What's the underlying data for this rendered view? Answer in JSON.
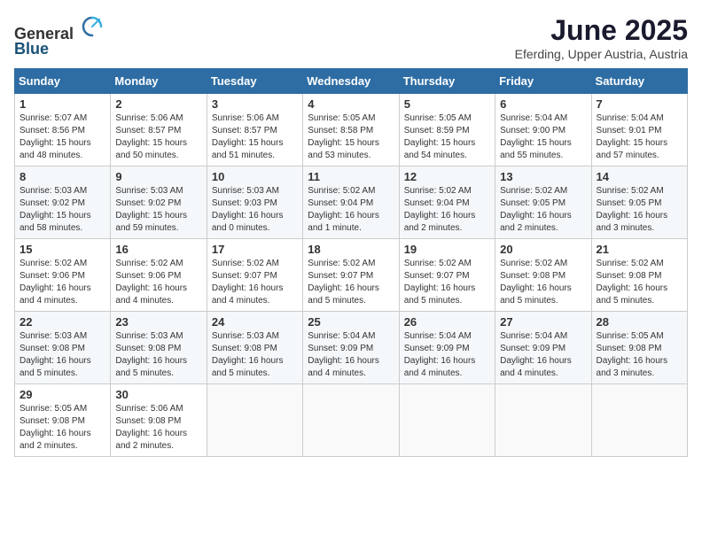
{
  "logo": {
    "general": "General",
    "blue": "Blue"
  },
  "title": "June 2025",
  "subtitle": "Eferding, Upper Austria, Austria",
  "weekdays": [
    "Sunday",
    "Monday",
    "Tuesday",
    "Wednesday",
    "Thursday",
    "Friday",
    "Saturday"
  ],
  "weeks": [
    [
      {
        "day": "1",
        "info": "Sunrise: 5:07 AM\nSunset: 8:56 PM\nDaylight: 15 hours\nand 48 minutes."
      },
      {
        "day": "2",
        "info": "Sunrise: 5:06 AM\nSunset: 8:57 PM\nDaylight: 15 hours\nand 50 minutes."
      },
      {
        "day": "3",
        "info": "Sunrise: 5:06 AM\nSunset: 8:57 PM\nDaylight: 15 hours\nand 51 minutes."
      },
      {
        "day": "4",
        "info": "Sunrise: 5:05 AM\nSunset: 8:58 PM\nDaylight: 15 hours\nand 53 minutes."
      },
      {
        "day": "5",
        "info": "Sunrise: 5:05 AM\nSunset: 8:59 PM\nDaylight: 15 hours\nand 54 minutes."
      },
      {
        "day": "6",
        "info": "Sunrise: 5:04 AM\nSunset: 9:00 PM\nDaylight: 15 hours\nand 55 minutes."
      },
      {
        "day": "7",
        "info": "Sunrise: 5:04 AM\nSunset: 9:01 PM\nDaylight: 15 hours\nand 57 minutes."
      }
    ],
    [
      {
        "day": "8",
        "info": "Sunrise: 5:03 AM\nSunset: 9:02 PM\nDaylight: 15 hours\nand 58 minutes."
      },
      {
        "day": "9",
        "info": "Sunrise: 5:03 AM\nSunset: 9:02 PM\nDaylight: 15 hours\nand 59 minutes."
      },
      {
        "day": "10",
        "info": "Sunrise: 5:03 AM\nSunset: 9:03 PM\nDaylight: 16 hours\nand 0 minutes."
      },
      {
        "day": "11",
        "info": "Sunrise: 5:02 AM\nSunset: 9:04 PM\nDaylight: 16 hours\nand 1 minute."
      },
      {
        "day": "12",
        "info": "Sunrise: 5:02 AM\nSunset: 9:04 PM\nDaylight: 16 hours\nand 2 minutes."
      },
      {
        "day": "13",
        "info": "Sunrise: 5:02 AM\nSunset: 9:05 PM\nDaylight: 16 hours\nand 2 minutes."
      },
      {
        "day": "14",
        "info": "Sunrise: 5:02 AM\nSunset: 9:05 PM\nDaylight: 16 hours\nand 3 minutes."
      }
    ],
    [
      {
        "day": "15",
        "info": "Sunrise: 5:02 AM\nSunset: 9:06 PM\nDaylight: 16 hours\nand 4 minutes."
      },
      {
        "day": "16",
        "info": "Sunrise: 5:02 AM\nSunset: 9:06 PM\nDaylight: 16 hours\nand 4 minutes."
      },
      {
        "day": "17",
        "info": "Sunrise: 5:02 AM\nSunset: 9:07 PM\nDaylight: 16 hours\nand 4 minutes."
      },
      {
        "day": "18",
        "info": "Sunrise: 5:02 AM\nSunset: 9:07 PM\nDaylight: 16 hours\nand 5 minutes."
      },
      {
        "day": "19",
        "info": "Sunrise: 5:02 AM\nSunset: 9:07 PM\nDaylight: 16 hours\nand 5 minutes."
      },
      {
        "day": "20",
        "info": "Sunrise: 5:02 AM\nSunset: 9:08 PM\nDaylight: 16 hours\nand 5 minutes."
      },
      {
        "day": "21",
        "info": "Sunrise: 5:02 AM\nSunset: 9:08 PM\nDaylight: 16 hours\nand 5 minutes."
      }
    ],
    [
      {
        "day": "22",
        "info": "Sunrise: 5:03 AM\nSunset: 9:08 PM\nDaylight: 16 hours\nand 5 minutes."
      },
      {
        "day": "23",
        "info": "Sunrise: 5:03 AM\nSunset: 9:08 PM\nDaylight: 16 hours\nand 5 minutes."
      },
      {
        "day": "24",
        "info": "Sunrise: 5:03 AM\nSunset: 9:08 PM\nDaylight: 16 hours\nand 5 minutes."
      },
      {
        "day": "25",
        "info": "Sunrise: 5:04 AM\nSunset: 9:09 PM\nDaylight: 16 hours\nand 4 minutes."
      },
      {
        "day": "26",
        "info": "Sunrise: 5:04 AM\nSunset: 9:09 PM\nDaylight: 16 hours\nand 4 minutes."
      },
      {
        "day": "27",
        "info": "Sunrise: 5:04 AM\nSunset: 9:09 PM\nDaylight: 16 hours\nand 4 minutes."
      },
      {
        "day": "28",
        "info": "Sunrise: 5:05 AM\nSunset: 9:08 PM\nDaylight: 16 hours\nand 3 minutes."
      }
    ],
    [
      {
        "day": "29",
        "info": "Sunrise: 5:05 AM\nSunset: 9:08 PM\nDaylight: 16 hours\nand 2 minutes."
      },
      {
        "day": "30",
        "info": "Sunrise: 5:06 AM\nSunset: 9:08 PM\nDaylight: 16 hours\nand 2 minutes."
      },
      {
        "day": "",
        "info": ""
      },
      {
        "day": "",
        "info": ""
      },
      {
        "day": "",
        "info": ""
      },
      {
        "day": "",
        "info": ""
      },
      {
        "day": "",
        "info": ""
      }
    ]
  ]
}
